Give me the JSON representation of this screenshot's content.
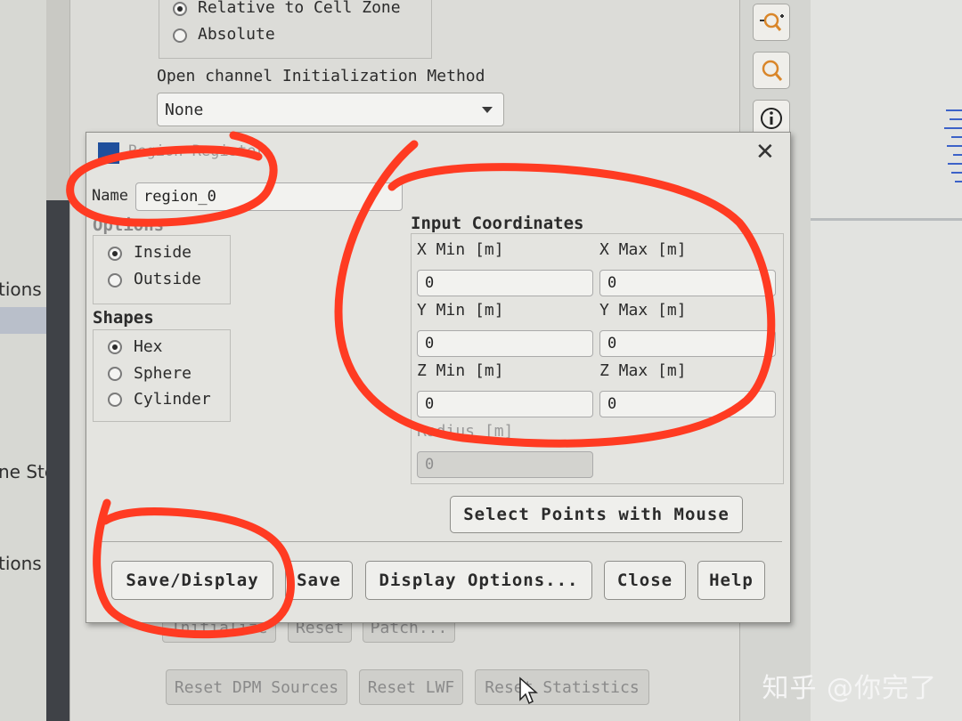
{
  "desktop_left": {
    "fragments": [
      "tions",
      "ne Ste",
      "tions"
    ]
  },
  "background_panel": {
    "zone_options": [
      "Relative to Cell Zone",
      "Absolute"
    ],
    "selected_zone": "Relative to Cell Zone",
    "open_channel_label": "Open channel Initialization Method",
    "open_channel_value": "None",
    "buttons_row1": [
      "Initialize",
      "Reset",
      "Patch..."
    ],
    "buttons_row2": [
      "Reset DPM Sources",
      "Reset LWF",
      "Reset Statistics"
    ]
  },
  "toolbar": {
    "icons": [
      "zoom-in-icon",
      "zoom-fit-icon",
      "info-icon"
    ]
  },
  "dialog": {
    "title": "Region Register",
    "close_glyph": "✕",
    "name_label": "Name",
    "name_value": "region_0",
    "options_title": "Options",
    "options": [
      "Inside",
      "Outside"
    ],
    "selected_option": "Inside",
    "shapes_title": "Shapes",
    "shapes": [
      "Hex",
      "Sphere",
      "Cylinder"
    ],
    "selected_shape": "Hex",
    "coords_title": "Input Coordinates",
    "x_min_label": "X Min [m]",
    "x_min": "0",
    "x_max_label": "X Max [m]",
    "x_max": "0",
    "y_min_label": "Y Min [m]",
    "y_min": "0",
    "y_max_label": "Y Max [m]",
    "y_max": "0",
    "z_min_label": "Z Min [m]",
    "z_min": "0",
    "z_max_label": "Z Max [m]",
    "z_max": "0",
    "radius_label": "Radius [m]",
    "radius": "0",
    "select_points_label": "Select Points with Mouse",
    "buttons": [
      "Save/Display",
      "Save",
      "Display Options...",
      "Close",
      "Help"
    ]
  },
  "watermark": "知乎 @你完了",
  "colors": {
    "annotation": "#ff3b22",
    "accent_icon": "#d9862a"
  }
}
